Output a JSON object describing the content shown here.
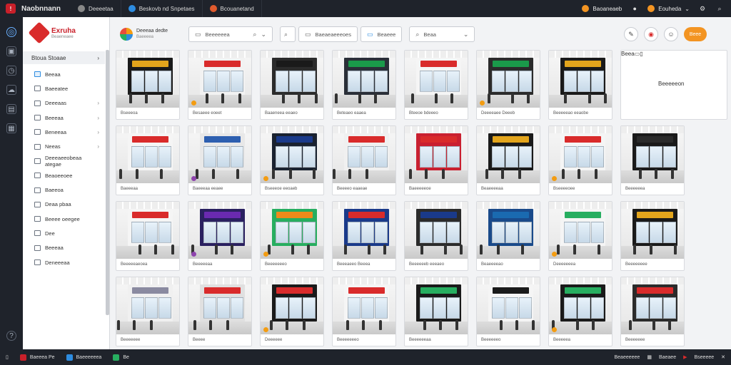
{
  "topbar": {
    "brand": "Naobnnann",
    "tabs": [
      {
        "label": "Deeeetaa",
        "icon": "globe-icon",
        "color": "#888888"
      },
      {
        "label": "Beskovb nd Snpetaes",
        "icon": "shield-icon",
        "color": "#2d8ce0"
      },
      {
        "label": "Bcouanetand",
        "icon": "fire-icon",
        "color": "#e05a2d"
      }
    ],
    "user_label": "Baoaneaeb",
    "user_badge": "1",
    "account_label": "Eouheda"
  },
  "sidebar": {
    "title": "Exruha",
    "subtitle": "Beaeneaee",
    "section": "Btoua Stoaae",
    "items": [
      {
        "label": "Beeaa",
        "chevron": false,
        "active": true
      },
      {
        "label": "Baeeatee",
        "chevron": false
      },
      {
        "label": "Deeeaas",
        "chevron": true
      },
      {
        "label": "Beeeaa",
        "chevron": true
      },
      {
        "label": "Beneeaa",
        "chevron": true
      },
      {
        "label": "Neeas",
        "chevron": true
      },
      {
        "label": "Deeeaeeobeaa ategae",
        "chevron": false
      },
      {
        "label": "Beaoeeoee",
        "chevron": false
      },
      {
        "label": "Baeeoa",
        "chevron": false
      },
      {
        "label": "Deaa pbaa",
        "chevron": false
      },
      {
        "label": "Beeee oeegee",
        "chevron": false
      },
      {
        "label": "Dee",
        "chevron": false
      },
      {
        "label": "Beeeaa",
        "chevron": false
      },
      {
        "label": "Deneeeaa",
        "chevron": false
      }
    ]
  },
  "toolbar": {
    "logo_title": "Deeeaa dedte",
    "logo_subtitle": "Baeeeea",
    "search_placeholder": "Beeeeeea",
    "filter1": "Baeaeaeeeoes",
    "filter2": "Beaeee",
    "filter3": "Beaa",
    "action_label": "Beee"
  },
  "cards": [
    {
      "caption": "Bseeeoa",
      "sign": "#e3a51c",
      "wall": "#1a1a1a",
      "badge": ""
    },
    {
      "caption": "Besaeee eoeet",
      "sign": "#d92b2b",
      "wall": "#f2f2f2",
      "badge": ""
    },
    {
      "caption": "Baaeneea eeaeo",
      "sign": "#1a1a1a",
      "wall": "#2b2b2b",
      "badge": ""
    },
    {
      "caption": "Beteaeo eaaea",
      "sign": "#1a9a4a",
      "wall": "#2a2f38",
      "badge": ""
    },
    {
      "caption": "Bteeoe bdeeeo",
      "sign": "#d92b2b",
      "wall": "#f5f5f5",
      "badge": ""
    },
    {
      "caption": "Deeeeaee Deeeb",
      "sign": "#1a9a4a",
      "wall": "#2b2b2b",
      "badge": ""
    },
    {
      "caption": "Beeeeeao eeaobe",
      "sign": "#e3a51c",
      "wall": "#1a1a1a",
      "badge": ""
    },
    {
      "caption": "Baeeeaa",
      "sign": "#d92b2b",
      "wall": "#f5f5f5",
      "badge": ""
    },
    {
      "caption": "Baeeeaa eeaee",
      "sign": "#2d5fb0",
      "wall": "#e8e8e8",
      "badge": "purple"
    },
    {
      "caption": "Bseeeoe eeoaeb",
      "sign": "#1a3a8a",
      "wall": "#1a2230",
      "badge": ""
    },
    {
      "caption": "Beeeeo eaaeae",
      "sign": "#d92b2b",
      "wall": "#f0f0f0",
      "badge": ""
    },
    {
      "caption": "Baeeeeeoe",
      "sign": "#d92b2b",
      "wall": "#c92030",
      "badge": ""
    },
    {
      "caption": "Beaeeeeaa",
      "sign": "#e3a51c",
      "wall": "#1a1a1a",
      "badge": ""
    },
    {
      "caption": "Bseeeeoee",
      "sign": "#d92b2b",
      "wall": "#f5f5f5",
      "badge": ""
    },
    {
      "caption": "Beeeeeea",
      "sign": "#2b2b2b",
      "wall": "#1a1a1a",
      "badge": ""
    },
    {
      "caption": "Beeeeeaeoea",
      "sign": "#d92b2b",
      "wall": "#f5f5f5",
      "badge": ""
    },
    {
      "caption": "Beeeeeaa",
      "sign": "#6a2ab0",
      "wall": "#2a2060",
      "badge": "purple"
    },
    {
      "caption": "Beeeeeeeo",
      "sign": "#f08a1a",
      "wall": "#27ae60",
      "badge": ""
    },
    {
      "caption": "Beeeaeeo Beeea",
      "sign": "#d92b2b",
      "wall": "#1a3a8a",
      "badge": ""
    },
    {
      "caption": "Beeeeeeb eeeaeo",
      "sign": "#1a3a8a",
      "wall": "#2b2b2b",
      "badge": ""
    },
    {
      "caption": "Beaeeeeao",
      "sign": "#1a6ab0",
      "wall": "#1a4a8a",
      "badge": ""
    },
    {
      "caption": "Deeeeeeea",
      "sign": "#27ae60",
      "wall": "#f5f5f5",
      "badge": ""
    },
    {
      "caption": "Beeeeeeee",
      "sign": "#e3a51c",
      "wall": "#1a1a1a",
      "badge": ""
    },
    {
      "caption": "Beeeeeee",
      "sign": "#8a8aa0",
      "wall": "#f0f0f0",
      "badge": ""
    },
    {
      "caption": "Beeee",
      "sign": "#d92b2b",
      "wall": "#e0e0e0",
      "badge": ""
    },
    {
      "caption": "Deeeeee",
      "sign": "#d92b2b",
      "wall": "#1a1a1a",
      "badge": ""
    },
    {
      "caption": "Beeeeeeeo",
      "sign": "#d92b2b",
      "wall": "#f5f5f5",
      "badge": ""
    },
    {
      "caption": "Beeeeeeaa",
      "sign": "#27ae60",
      "wall": "#1a1a1a",
      "badge": ""
    },
    {
      "caption": "Beeeeeeo",
      "sign": "#1a1a1a",
      "wall": "#f5f5f5",
      "badge": ""
    },
    {
      "caption": "Beeeeea",
      "sign": "#27ae60",
      "wall": "#1a1a1a",
      "badge": ""
    },
    {
      "caption": "Beeeeeee",
      "sign": "#d92b2b",
      "wall": "#2b2b2b",
      "badge": ""
    },
    {
      "caption": "Beeeeeeo",
      "sign": "#1a3a8a",
      "wall": "#2b2b2b",
      "badge": ""
    }
  ],
  "feature": {
    "title": "Beeeeeon",
    "caption": "Beea"
  },
  "bottombar": {
    "items": [
      {
        "label": "Baeeea Pe",
        "color": "#c9202a"
      },
      {
        "label": "Baeeeeeea",
        "color": "#2d8ce0"
      },
      {
        "label": "Be",
        "color": "#27ae60"
      }
    ],
    "right_items": [
      "Beaeeeeee",
      "Baeaee",
      "Bseeeee"
    ]
  }
}
